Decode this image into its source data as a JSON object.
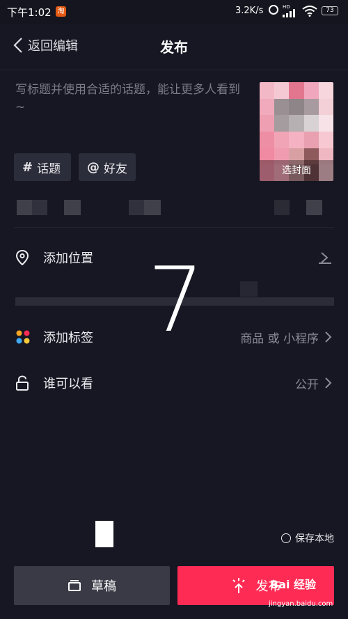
{
  "status_bar": {
    "time": "下午1:02",
    "app_badge": "淘",
    "speed": "3.2K/s",
    "hd": "HD",
    "battery": "73"
  },
  "nav": {
    "back_label": "返回编辑",
    "title": "发布"
  },
  "caption": {
    "placeholder": "写标题并使用合适的话题，能让更多人看到~"
  },
  "cover": {
    "label": "选封面"
  },
  "chips": [
    {
      "symbol": "#",
      "label": "话题"
    },
    {
      "symbol": "@",
      "label": "好友"
    }
  ],
  "rows": {
    "location": {
      "label": "添加位置"
    },
    "tags": {
      "label": "添加标签",
      "value": "商品 或 小程序"
    },
    "privacy": {
      "label": "谁可以看",
      "value": "公开"
    }
  },
  "overlay": {
    "number": "7"
  },
  "save_local": {
    "label": "保存本地"
  },
  "buttons": {
    "draft": "草稿",
    "publish": "发布"
  },
  "watermark": {
    "main": "Bai 经验",
    "sub": "jingyan.baidu.com"
  },
  "colors": {
    "background": "#161722",
    "publish_accent": "#fe2c55",
    "draft_button": "#393a45",
    "chip": "#2c2d3a"
  }
}
